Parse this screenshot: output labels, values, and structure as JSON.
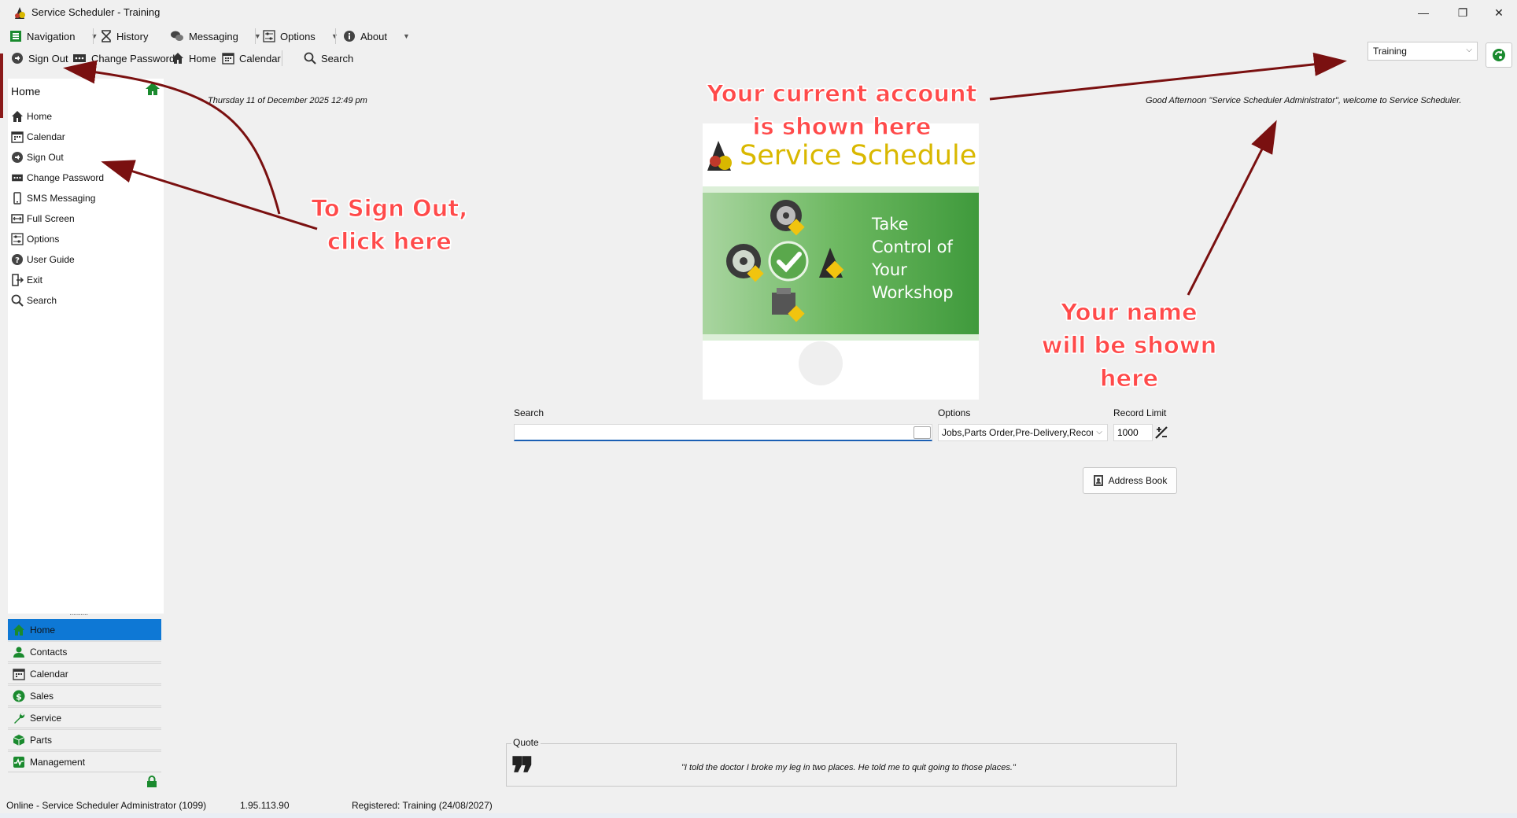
{
  "window": {
    "title": "Service Scheduler - Training",
    "min_glyph": "—",
    "max_glyph": "❐",
    "close_glyph": "✕"
  },
  "menu": {
    "navigation": "Navigation",
    "history": "History",
    "messaging": "Messaging",
    "options": "Options",
    "about": "About"
  },
  "toolbar": {
    "sign_out": "Sign Out",
    "change_password": "Change Password",
    "home": "Home",
    "calendar": "Calendar",
    "search": "Search"
  },
  "account": {
    "selected": "Training"
  },
  "sidebar": {
    "header": "Home",
    "items": [
      {
        "label": "Home",
        "icon": "home-icon"
      },
      {
        "label": "Calendar",
        "icon": "calendar-icon"
      },
      {
        "label": "Sign Out",
        "icon": "sign-out-icon"
      },
      {
        "label": "Change Password",
        "icon": "password-icon"
      },
      {
        "label": "SMS Messaging",
        "icon": "phone-icon"
      },
      {
        "label": "Full Screen",
        "icon": "full-screen-icon"
      },
      {
        "label": "Options",
        "icon": "options-icon"
      },
      {
        "label": "User Guide",
        "icon": "help-icon"
      },
      {
        "label": "Exit",
        "icon": "exit-icon"
      },
      {
        "label": "Search",
        "icon": "search-icon"
      }
    ],
    "grip": "··········"
  },
  "nav_buttons": [
    {
      "label": "Home",
      "icon": "home-icon",
      "color": "#1a8a2e",
      "active": true
    },
    {
      "label": "Contacts",
      "icon": "contacts-icon",
      "color": "#1a8a2e"
    },
    {
      "label": "Calendar",
      "icon": "calendar-icon",
      "color": "#333333"
    },
    {
      "label": "Sales",
      "icon": "dollar-icon",
      "color": "#1a8a2e"
    },
    {
      "label": "Service",
      "icon": "wrench-icon",
      "color": "#1a8a2e"
    },
    {
      "label": "Parts",
      "icon": "box-icon",
      "color": "#1a8a2e"
    },
    {
      "label": "Management",
      "icon": "pulse-icon",
      "color": "#1a8a2e"
    }
  ],
  "main": {
    "date": "Thursday 11 of December 2025 12:49 pm",
    "welcome": "Good Afternoon \"Service Scheduler Administrator\", welcome to Service Scheduler.",
    "splash": {
      "title": "Service Scheduler",
      "tagline": [
        "Take",
        "Control of",
        "Your",
        "Workshop"
      ]
    },
    "search_label": "Search",
    "search_value": "",
    "options_label": "Options",
    "options_value": "Jobs,Parts Order,Pre-Delivery,Reconc",
    "limit_label": "Record Limit",
    "limit_value": "1000",
    "address_book": "Address Book",
    "quote_label": "Quote",
    "quote_mark": "❞",
    "quote_text": "\"I told the doctor I broke my leg in two places. He told me to quit going to those places.\""
  },
  "status": {
    "user": "Online - Service Scheduler Administrator (1099)",
    "version": "1.95.113.90",
    "registered": "Registered: Training (24/08/2027)"
  },
  "annotations": {
    "account": [
      "Your current account",
      "is shown here"
    ],
    "signout": [
      "To Sign Out,",
      "click here"
    ],
    "name": [
      "Your name",
      "will be shown",
      "here"
    ]
  },
  "colors": {
    "accent_green": "#1a8a2e",
    "active_nav": "#0e78d5",
    "annotation_red": "#ff4a4a",
    "arrow_red": "#7a1010",
    "splash_green": "#3f9a3c",
    "splash_title": "#d9b800"
  }
}
